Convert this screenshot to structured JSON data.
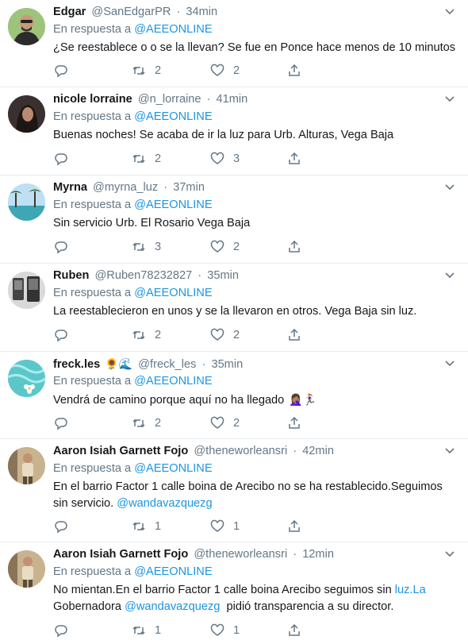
{
  "reply_prefix": "En respuesta a",
  "reply_target": "@AEEONLINE",
  "tweets": [
    {
      "name": "Edgar",
      "handle": "@SanEdgarPR",
      "time": "34min",
      "text_parts": [
        "¿Se reestablece o o se la llevan? Se fue en Ponce hace menos de 10 minutos"
      ],
      "retweets": "2",
      "likes": "2",
      "avatar": "man-with-glasses"
    },
    {
      "name": "nicole lorraine",
      "handle": "@n_lorraine",
      "time": "41min",
      "text_parts": [
        "Buenas noches! Se acaba de ir la luz para Urb. Alturas, Vega Baja"
      ],
      "retweets": "2",
      "likes": "3",
      "avatar": "woman-portrait"
    },
    {
      "name": "Myrna",
      "handle": "@myrna_luz",
      "time": "37min",
      "text_parts": [
        "Sin servicio Urb. El Rosario Vega Baja"
      ],
      "retweets": "3",
      "likes": "2",
      "avatar": "palm-beach"
    },
    {
      "name": "Ruben",
      "handle": "@Ruben78232827",
      "time": "35min",
      "text_parts": [
        "La reestablecieron en unos y se la llevaron en otros. Vega Baja sin luz."
      ],
      "retweets": "2",
      "likes": "2",
      "avatar": "phones"
    },
    {
      "name": "freck.les",
      "name_emoji": "🌻🌊",
      "handle": "@freck_les",
      "time": "35min",
      "text_parts": [
        "Vendrá de camino porque aquí no ha llegado",
        "🤦🏽‍♀️🏃🏼‍♀️"
      ],
      "retweets": "2",
      "likes": "2",
      "avatar": "water-flower"
    },
    {
      "name": "Aaron Isiah Garnett Fojo",
      "handle": "@theneworleansri",
      "time": "42min",
      "text_parts": [
        "En el barrio Factor 1 calle boina de Arecibo no se ha restablecido.Seguimos sin servicio. ",
        "@wandavazquezg"
      ],
      "retweets": "1",
      "likes": "1",
      "avatar": "man-standing"
    },
    {
      "name": "Aaron Isiah Garnett Fojo",
      "handle": "@theneworleansri",
      "time": "12min",
      "text_parts": [
        "No mientan.En el barrio Factor 1 calle boina Arecibo seguimos sin ",
        "luz.La",
        " Gobernadora ",
        "@wandavazquezg",
        "  pidió transparencia a su director."
      ],
      "retweets": "1",
      "likes": "1",
      "avatar": "man-standing"
    }
  ],
  "colors": {
    "text": "#14171a",
    "secondary": "#657786",
    "link": "#1b95e0",
    "divider": "#e6ecf0"
  }
}
